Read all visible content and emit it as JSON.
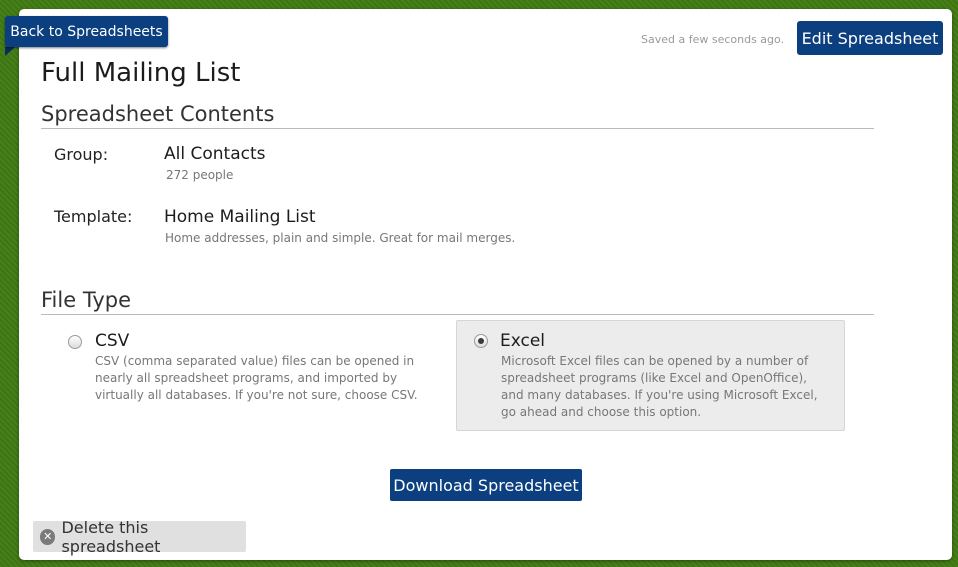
{
  "nav": {
    "back_label": "Back to Spreadsheets"
  },
  "header": {
    "saved_status": "Saved a few seconds ago.",
    "edit_label": "Edit Spreadsheet",
    "title": "Full Mailing List"
  },
  "contents": {
    "heading": "Spreadsheet Contents",
    "group": {
      "label": "Group:",
      "value": "All Contacts",
      "detail": "272 people"
    },
    "template": {
      "label": "Template:",
      "value": "Home Mailing List",
      "detail": "Home addresses, plain and simple. Great for mail merges."
    }
  },
  "file_type": {
    "heading": "File Type",
    "options": [
      {
        "title": "CSV",
        "selected": false,
        "description": "CSV (comma separated value) files can be opened in nearly all spreadsheet programs, and imported by virtually all databases. If you're not sure, choose CSV."
      },
      {
        "title": "Excel",
        "selected": true,
        "description": "Microsoft Excel files can be opened by a number of spreadsheet programs (like Excel and OpenOffice), and many databases. If you're using Microsoft Excel, go ahead and choose this option."
      }
    ]
  },
  "actions": {
    "download_label": "Download Spreadsheet",
    "delete_label": "Delete this spreadsheet",
    "delete_icon": "close-circle-icon"
  },
  "colors": {
    "background": "#3f7a12",
    "primary_button": "#0b3f7f",
    "selected_option_bg": "#ececec"
  }
}
